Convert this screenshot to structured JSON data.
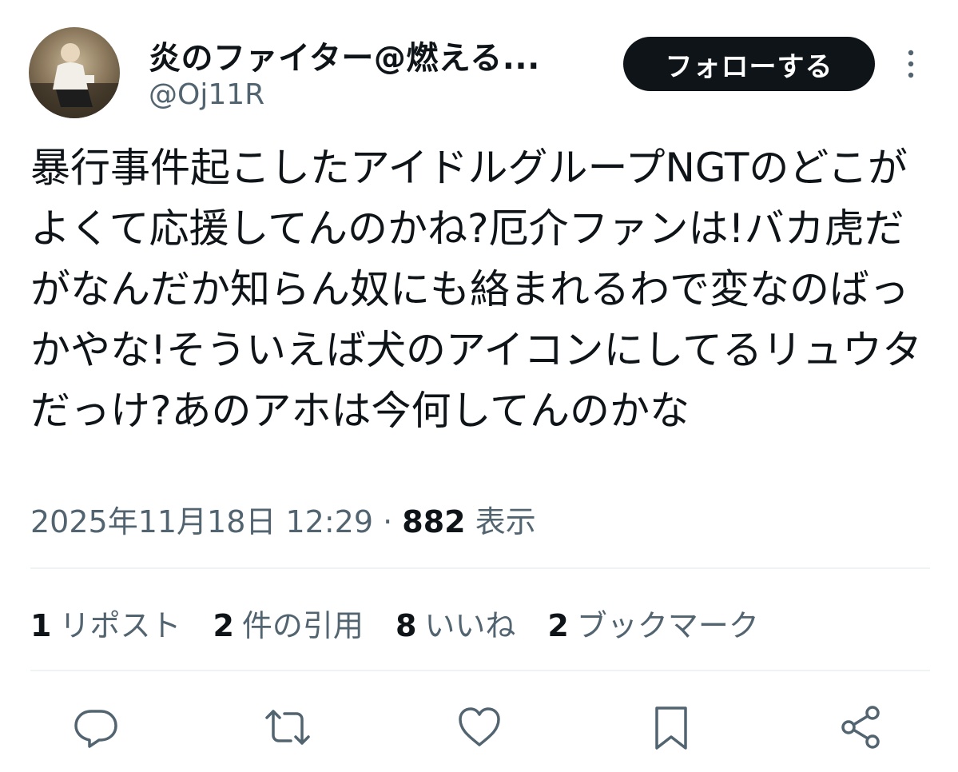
{
  "author": {
    "display_name": "炎のファイター@燃える...",
    "handle": "@Oj11R"
  },
  "follow_button": {
    "label": "フォローする"
  },
  "tweet": {
    "text": "暴行事件起こしたアイドルグループNGTのどこがよくて応援してんのかね?厄介ファンは!バカ虎だがなんだか知らん奴にも絡まれるわで変なのばっかやな!そういえば犬のアイコンにしてるリュウタだっけ?あのアホは今何してんのかな",
    "timestamp": "2025年11月18日 12:29",
    "separator": "·",
    "views_count": "882",
    "views_label": "表示"
  },
  "stats": {
    "reposts": {
      "count": "1",
      "label": "リポスト"
    },
    "quotes": {
      "count": "2",
      "label": "件の引用"
    },
    "likes": {
      "count": "8",
      "label": "いいね"
    },
    "bookmarks": {
      "count": "2",
      "label": "ブックマーク"
    }
  },
  "icons": {
    "avatar": "user-avatar",
    "more": "more-vertical-icon",
    "reply": "reply-icon",
    "repost": "repost-icon",
    "like": "like-icon",
    "bookmark": "bookmark-icon",
    "share": "share-icon"
  },
  "colors": {
    "text_primary": "#0f1419",
    "text_secondary": "#536471",
    "button_bg": "#0f1419",
    "divider": "#eff3f4"
  }
}
